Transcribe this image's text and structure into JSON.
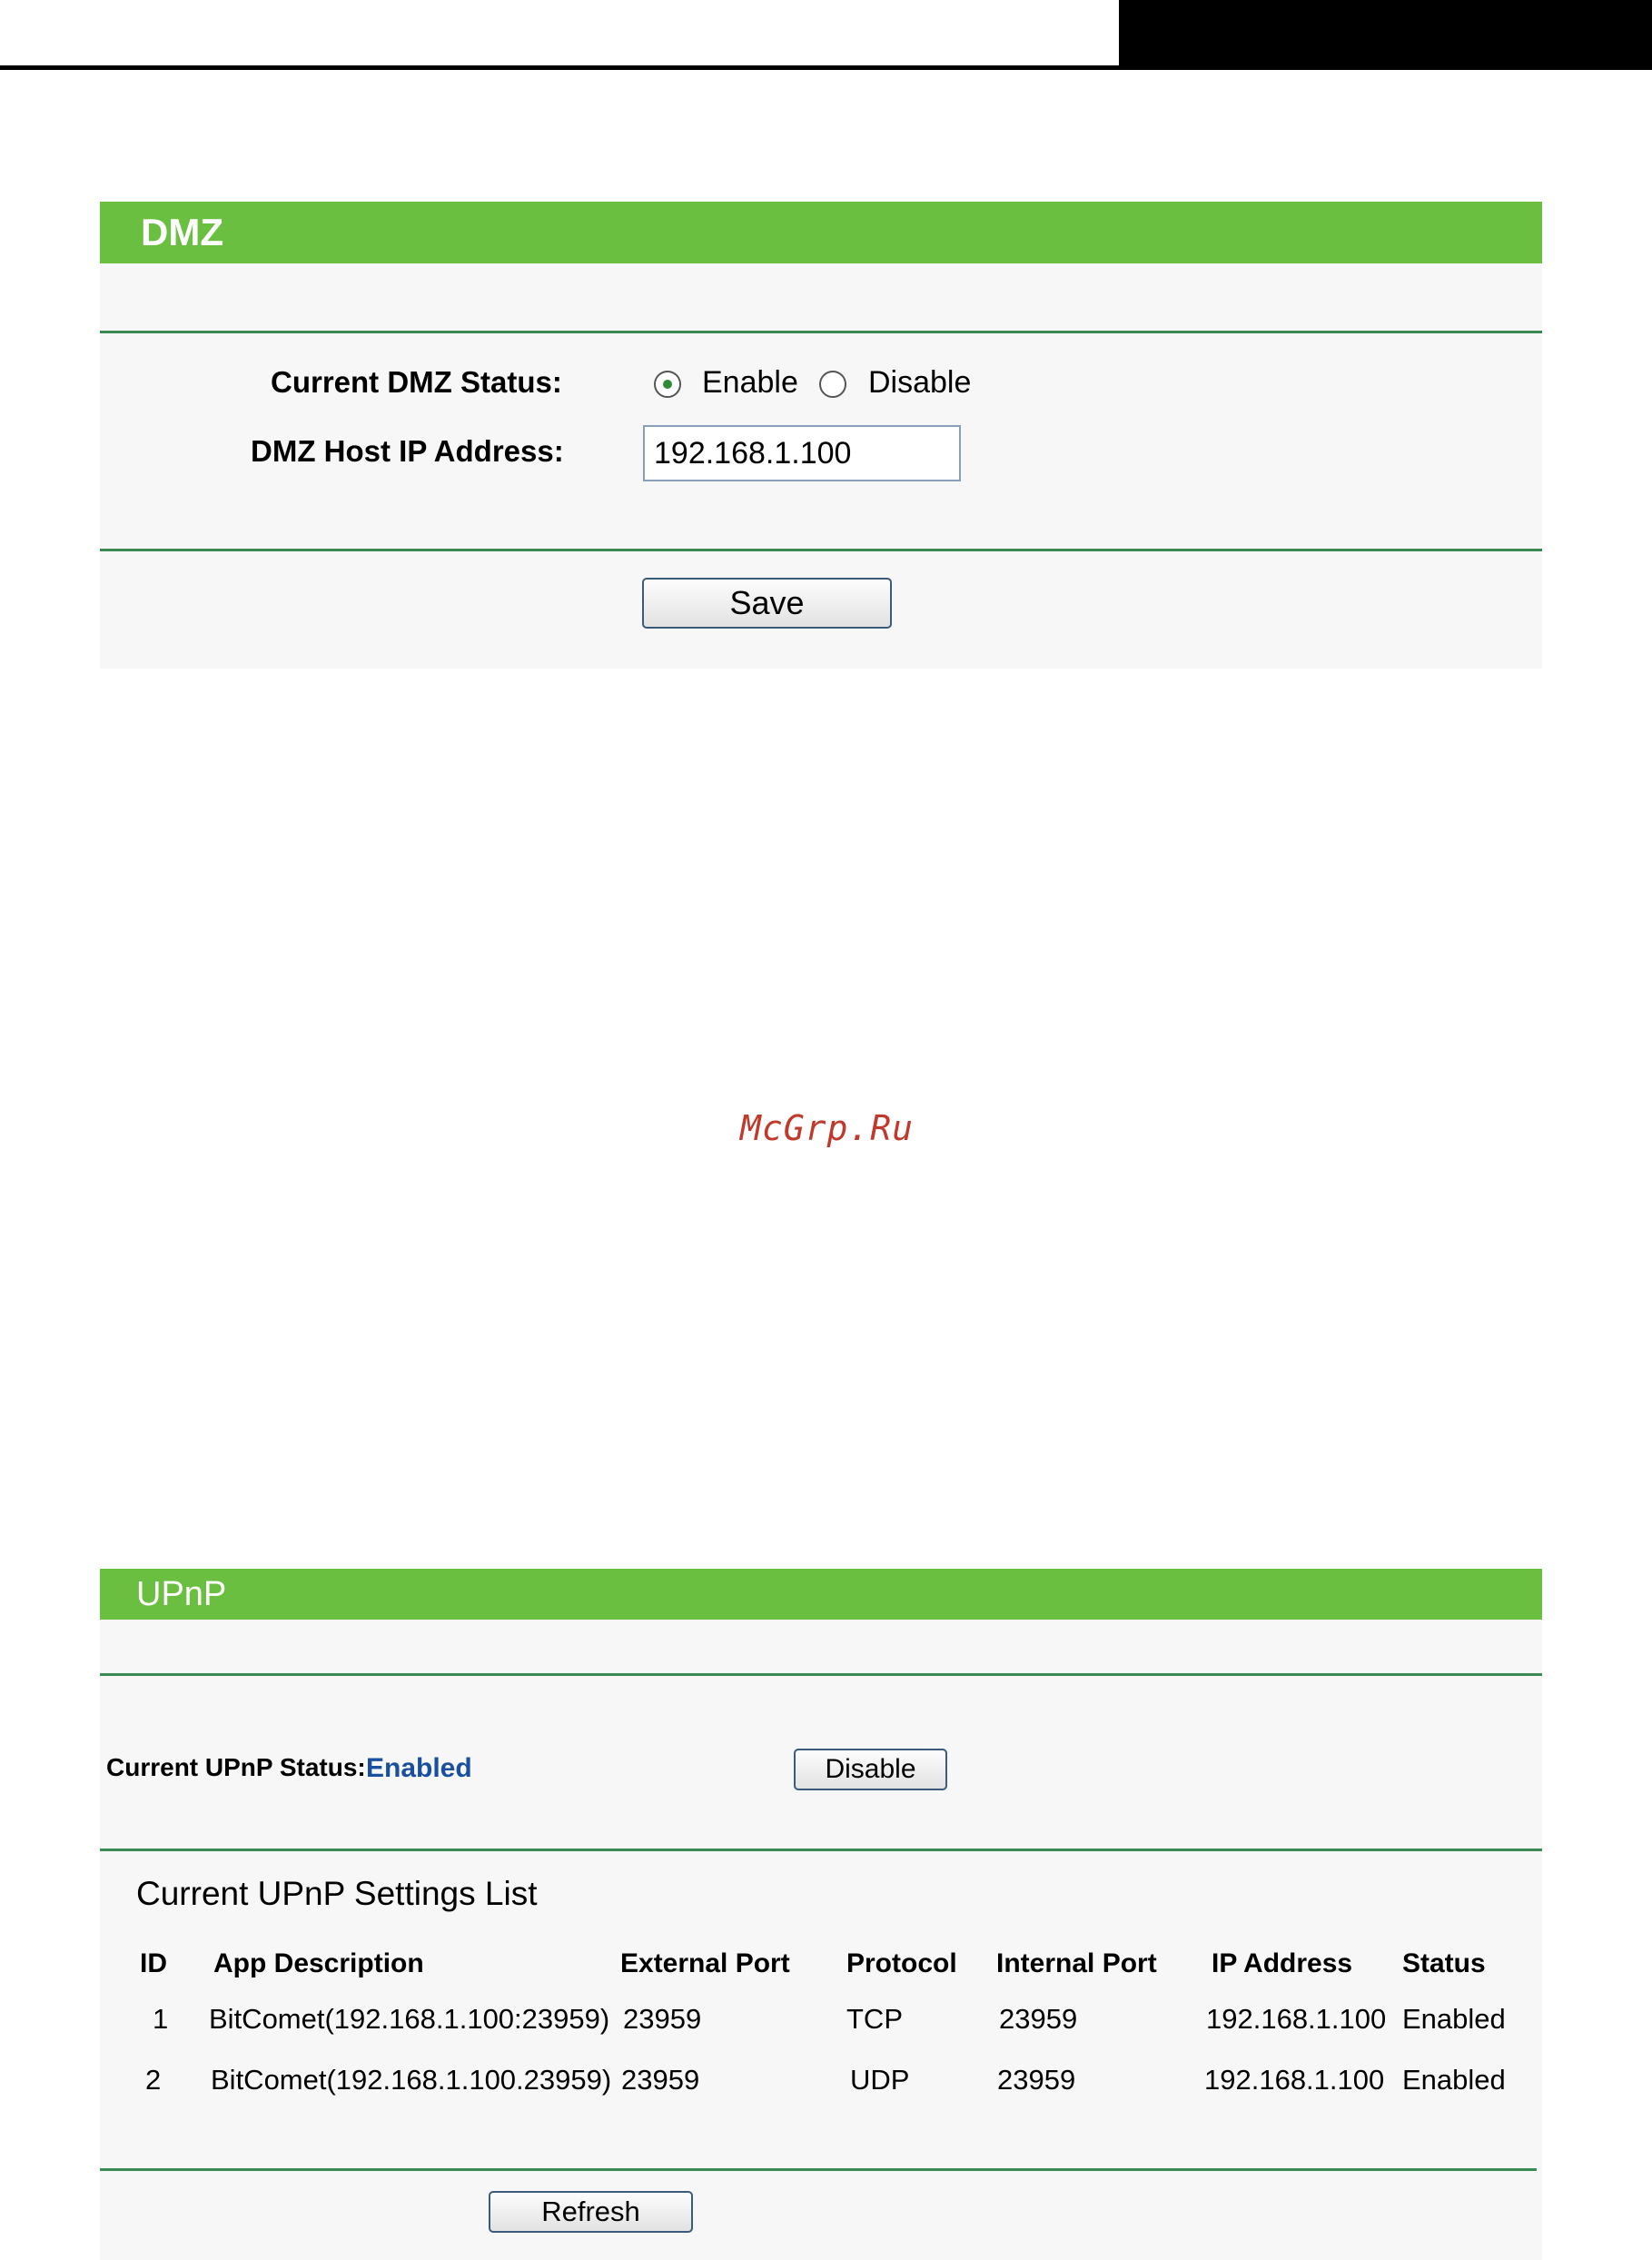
{
  "dmz": {
    "title": "DMZ",
    "status_label": "Current DMZ Status:",
    "enable_label": "Enable",
    "disable_label": "Disable",
    "selected": "Enable",
    "host_ip_label": "DMZ Host IP Address:",
    "host_ip_value": "192.168.1.100",
    "save_label": "Save"
  },
  "watermark": "McGrp.Ru",
  "upnp": {
    "title": "UPnP",
    "status_label": "Current UPnP Status:",
    "status_value": "Enabled",
    "disable_label": "Disable",
    "list_title": "Current UPnP Settings List",
    "columns": [
      "ID",
      "App Description",
      "External Port",
      "Protocol",
      "Internal Port",
      "IP Address",
      "Status"
    ],
    "rows": [
      [
        "1",
        "BitComet(192.168.1.100:23959)",
        "23959",
        "TCP",
        "23959",
        "192.168.1.100",
        "Enabled"
      ],
      [
        "2",
        "BitComet(192.168.1.100.23959)",
        "23959",
        "UDP",
        "23959",
        "192.168.1.100",
        "Enabled"
      ]
    ],
    "refresh_label": "Refresh"
  },
  "colors": {
    "title_bar": "#6abf40",
    "divider": "#3a8a55",
    "status_enabled": "#1a4fa0",
    "watermark": "#c0392b"
  }
}
